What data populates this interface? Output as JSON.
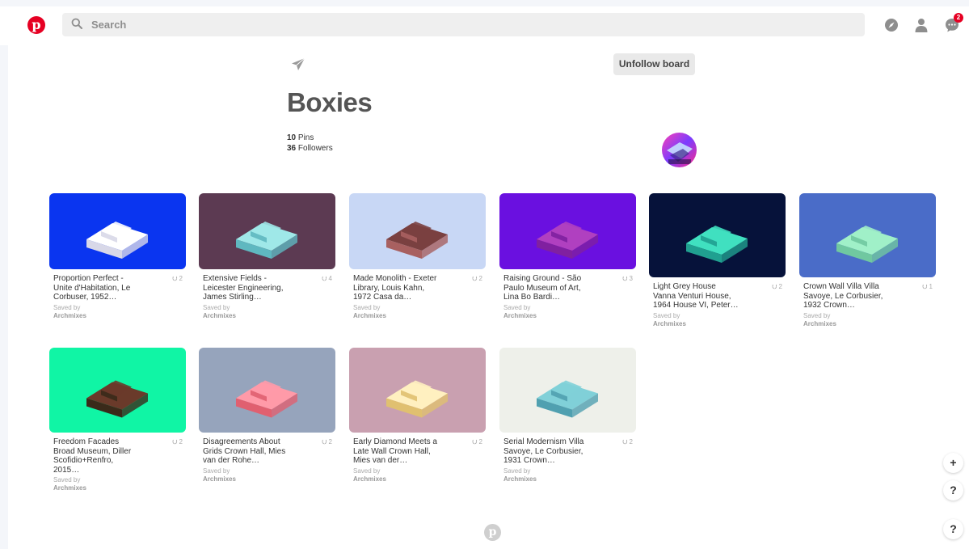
{
  "header": {
    "logo_letter": "p",
    "search_placeholder": "Search",
    "notification_count": "2"
  },
  "board": {
    "unfollow_label": "Unfollow board",
    "title": "Boxies",
    "pins_count": "10",
    "pins_label": " Pins",
    "followers_count": "36",
    "followers_label": " Followers"
  },
  "pins": [
    {
      "title_lines": [
        "Proportion Perfect -",
        "Unite d'Habitation, Le",
        "Corbuser, 1952…"
      ],
      "count": "2",
      "saved_by_label": "Saved by",
      "saved_by": "Archmixes",
      "bg": "#0a35f0"
    },
    {
      "title_lines": [
        "Extensive Fields -",
        "Leicester Engineering,",
        "James Stirling…"
      ],
      "count": "4",
      "saved_by_label": "Saved by",
      "saved_by": "Archmixes",
      "bg": "#5c3a52"
    },
    {
      "title_lines": [
        "Made Monolith - Exeter",
        "Library, Louis Kahn,",
        "1972 Casa da…"
      ],
      "count": "2",
      "saved_by_label": "Saved by",
      "saved_by": "Archmixes",
      "bg": "#c8d7f5"
    },
    {
      "title_lines": [
        "Raising Ground - São",
        "Paulo Museum of Art,",
        "Lina Bo Bardi…"
      ],
      "count": "3",
      "saved_by_label": "Saved by",
      "saved_by": "Archmixes",
      "bg": "#6a10e0"
    },
    {
      "title_lines": [
        "Light Grey House",
        "Vanna Venturi House,",
        "1964 House VI, Peter…"
      ],
      "count": "2",
      "saved_by_label": "Saved by",
      "saved_by": "Archmixes",
      "bg": "#06123a"
    },
    {
      "title_lines": [
        "Crown Wall Villa Villa",
        "Savoye, Le Corbusier,",
        "1932 Crown…"
      ],
      "count": "1",
      "saved_by_label": "Saved by",
      "saved_by": "Archmixes",
      "bg": "#4a6cc8"
    },
    {
      "title_lines": [
        "Freedom Facades",
        "Broad Museum, Diller",
        "Scofidio+Renfro,",
        "2015…"
      ],
      "count": "2",
      "saved_by_label": "Saved by",
      "saved_by": "Archmixes",
      "bg": "#10f5a5"
    },
    {
      "title_lines": [
        "Disagreements About",
        "Grids Crown Hall, Mies",
        "van der Rohe…"
      ],
      "count": "2",
      "saved_by_label": "Saved by",
      "saved_by": "Archmixes",
      "bg": "#96a4bc"
    },
    {
      "title_lines": [
        "Early Diamond Meets a",
        "Late Wall Crown Hall,",
        "Mies van der…"
      ],
      "count": "2",
      "saved_by_label": "Saved by",
      "saved_by": "Archmixes",
      "bg": "#c9a0b0"
    },
    {
      "title_lines": [
        "Serial Modernism Villa",
        "Savoye, Le Corbusier,",
        "1931 Crown…"
      ],
      "count": "2",
      "saved_by_label": "Saved by",
      "saved_by": "Archmixes",
      "bg": "#eef0ea"
    }
  ],
  "floating": {
    "plus": "+",
    "help": "?"
  },
  "icons": [
    "search-icon",
    "compass-icon",
    "profile-icon",
    "messages-icon",
    "send-icon",
    "pin-icon"
  ]
}
